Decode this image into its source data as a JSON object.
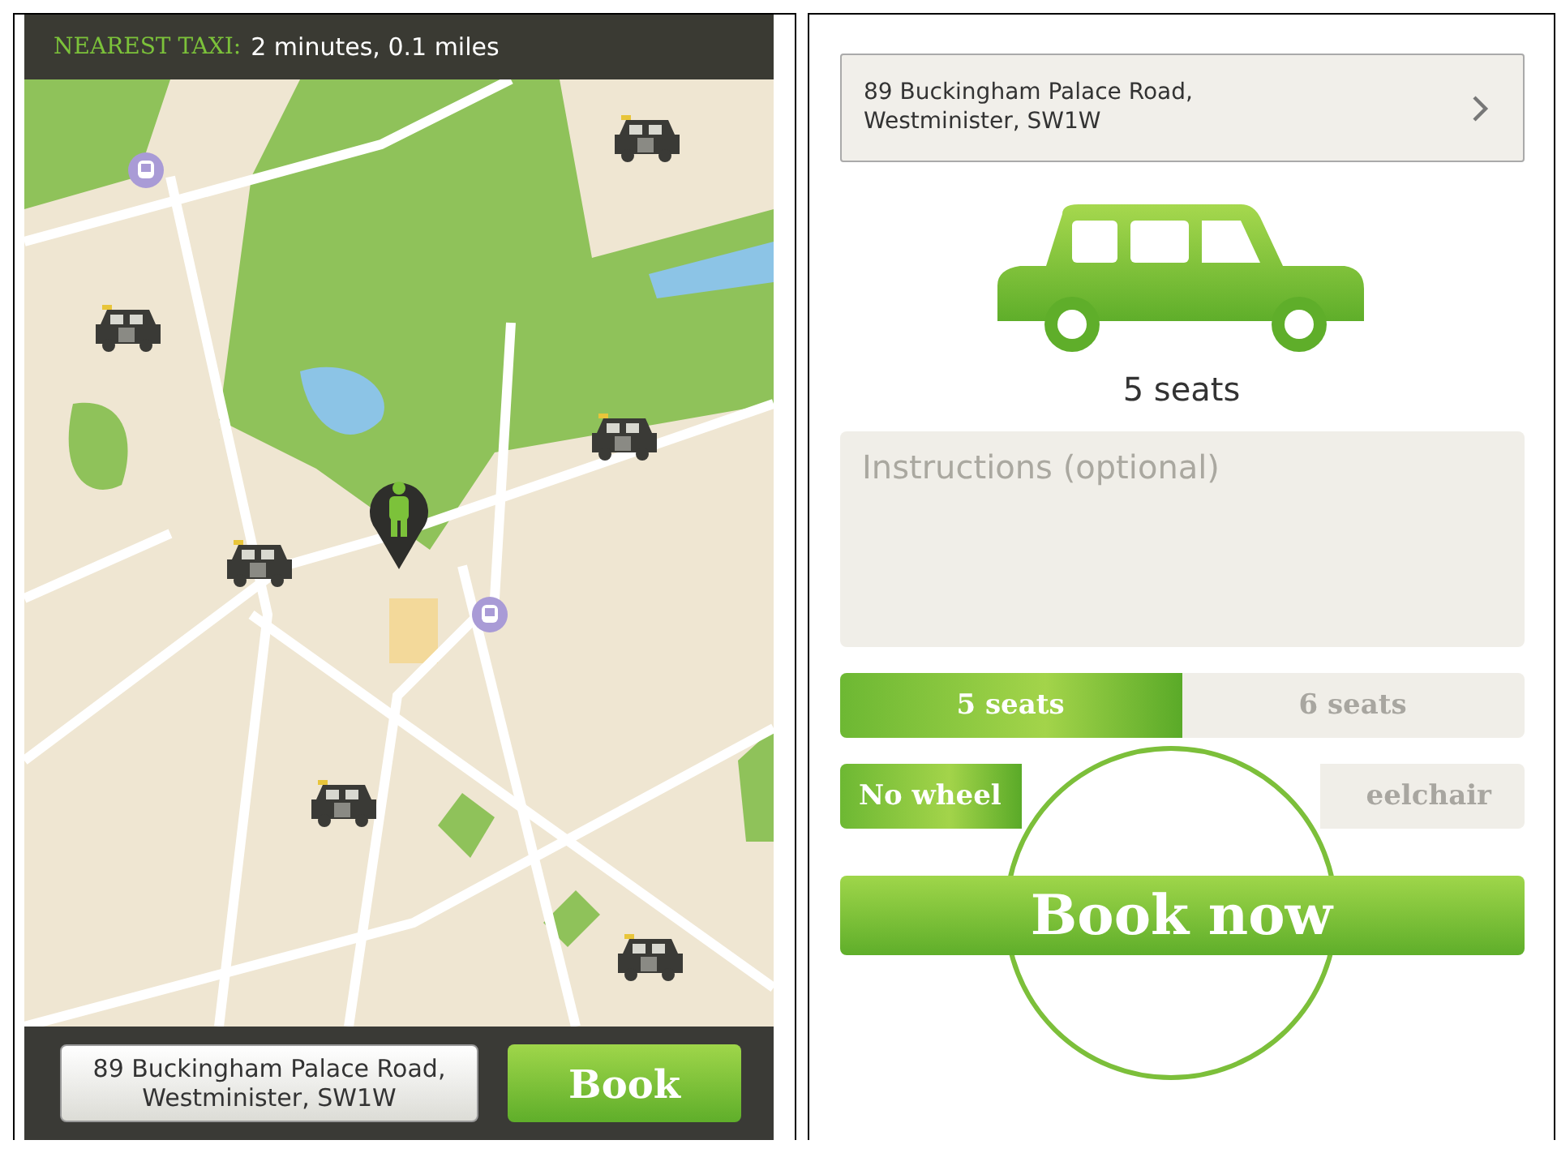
{
  "left_screen": {
    "nearest_taxi": {
      "label": "NEAREST TAXI:",
      "value": "2 minutes, 0.1 miles"
    },
    "address_button": {
      "label": "89 Buckingham Palace Road, Westminister, SW1W"
    },
    "book_button": {
      "label": "Book"
    }
  },
  "right_screen": {
    "address_field": {
      "value": "89 Buckingham Palace Road, Westminister, SW1W"
    },
    "vehicle_caption": "5 seats",
    "instructions": {
      "placeholder": "Instructions (optional)"
    },
    "toggle_groups": [
      {
        "options": [
          {
            "label": "5 seats",
            "selected": true
          },
          {
            "label": "6 seats",
            "selected": false
          }
        ]
      },
      {
        "options": [
          {
            "label": "No wheel",
            "selected": true
          },
          {
            "label": "eelchair",
            "selected": false
          }
        ]
      }
    ],
    "book_now_button": {
      "label": "Book now"
    }
  }
}
